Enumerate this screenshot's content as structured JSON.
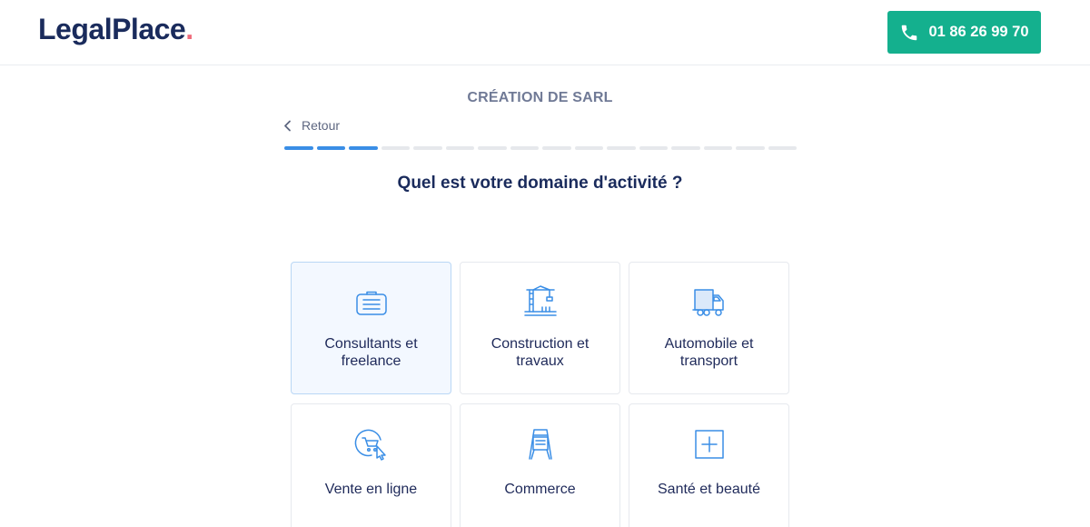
{
  "header": {
    "logo_text": "LegalPlace",
    "logo_dot": ".",
    "phone": "01 86 26 99 70"
  },
  "page": {
    "title": "CRÉATION DE SARL",
    "back_label": "Retour",
    "question": "Quel est votre domaine d'activité ?",
    "progress": {
      "completed_steps": 3,
      "total_steps": 16
    }
  },
  "options": [
    {
      "label": "Consultants et freelance",
      "icon": "briefcase-icon",
      "selected": true
    },
    {
      "label": "Construction et travaux",
      "icon": "crane-icon",
      "selected": false
    },
    {
      "label": "Automobile et transport",
      "icon": "truck-icon",
      "selected": false
    },
    {
      "label": "Vente en ligne",
      "icon": "online-cart-icon",
      "selected": false
    },
    {
      "label": "Commerce",
      "icon": "sign-board-icon",
      "selected": false
    },
    {
      "label": "Santé et beauté",
      "icon": "medical-cross-icon",
      "selected": false
    }
  ],
  "colors": {
    "brand_navy": "#1a2b5c",
    "logo_dot": "#ef6b7b",
    "phone_button": "#14b08e",
    "progress_active": "#3a8ee6",
    "icon_blue": "#3a8ee6"
  }
}
